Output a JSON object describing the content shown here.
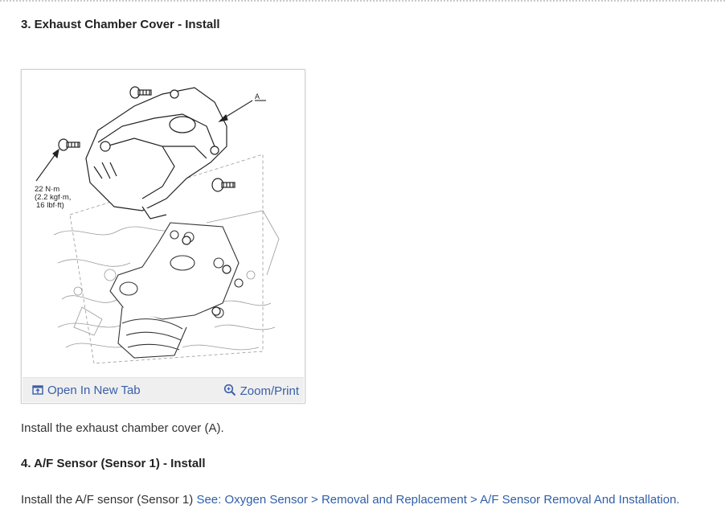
{
  "step3": {
    "heading": "3. Exhaust Chamber Cover - Install"
  },
  "figure": {
    "callout_letter": "A",
    "torque_line1": "22 N·m",
    "torque_line2": "(2.2 kgf·m,",
    "torque_line3": "16 lbf·ft)",
    "open_tab_label": "Open In New Tab",
    "zoom_print_label": "Zoom/Print",
    "icons": {
      "open_tab": "open-new-tab-icon",
      "zoom": "zoom-magnifier-icon"
    },
    "link_color": "#3b5ea8"
  },
  "step3_text": "Install the exhaust chamber cover (A).",
  "step4": {
    "heading": "4. A/F Sensor (Sensor 1) - Install"
  },
  "step4_text": {
    "prefix": "Install the A/F sensor (Sensor 1) ",
    "link": "See: Oxygen Sensor > Removal and Replacement > A/F Sensor Removal And Installation."
  }
}
